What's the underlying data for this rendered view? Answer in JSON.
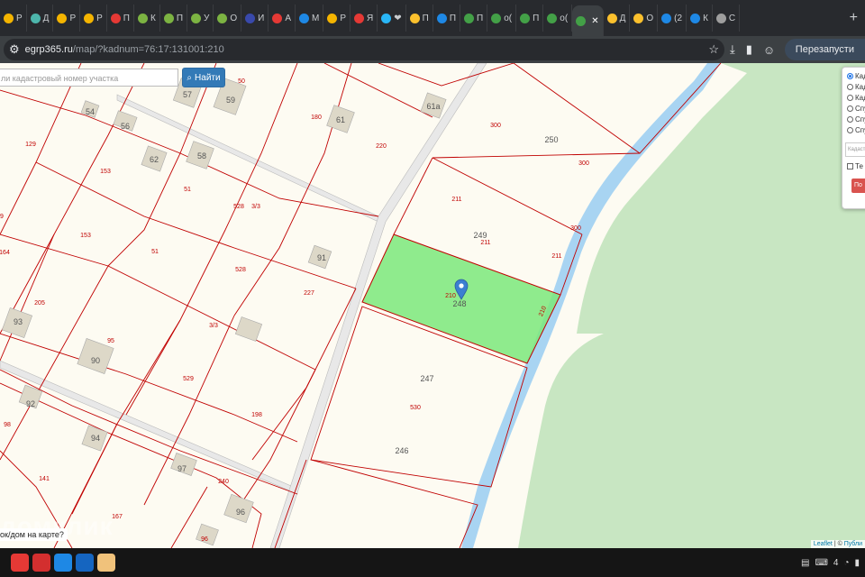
{
  "tabs": [
    {
      "label": "Р",
      "color": "#f4b400"
    },
    {
      "label": "Д",
      "color": "#4db6ac"
    },
    {
      "label": "Р",
      "color": "#f4b400"
    },
    {
      "label": "Р",
      "color": "#f4b400"
    },
    {
      "label": "П",
      "color": "#e53935"
    },
    {
      "label": "К",
      "color": "#7cb342"
    },
    {
      "label": "П",
      "color": "#7cb342"
    },
    {
      "label": "У",
      "color": "#7cb342"
    },
    {
      "label": "О",
      "color": "#7cb342"
    },
    {
      "label": "И",
      "color": "#3949ab"
    },
    {
      "label": "А",
      "color": "#e53935"
    },
    {
      "label": "М",
      "color": "#1e88e5"
    },
    {
      "label": "Р",
      "color": "#f4b400"
    },
    {
      "label": "Я",
      "color": "#e53935"
    },
    {
      "label": "❤",
      "color": "#29b6f6"
    },
    {
      "label": "П",
      "color": "#fbc02d"
    },
    {
      "label": "П",
      "color": "#1e88e5"
    },
    {
      "label": "П",
      "color": "#43a047"
    },
    {
      "label": "о(",
      "color": "#43a047"
    },
    {
      "label": "П",
      "color": "#43a047"
    },
    {
      "label": "о(",
      "color": "#43a047"
    },
    {
      "label": "",
      "color": "#43a047",
      "active": true
    },
    {
      "label": "Д",
      "color": "#fbc02d"
    },
    {
      "label": "О",
      "color": "#fbc02d"
    },
    {
      "label": "(2",
      "color": "#1e88e5"
    },
    {
      "label": "К",
      "color": "#1e88e5"
    },
    {
      "label": "С",
      "color": "#9e9e9e"
    }
  ],
  "toolbar": {
    "url_site": "egrp365.ru",
    "url_path": "/map/?kadnum=76:17:131001:210",
    "relaunch_label": "Перезапусти"
  },
  "map": {
    "search_placeholder": "ли кадастровый номер участка",
    "search_button": "Найти",
    "panel_options": [
      {
        "label": "Кад",
        "checked": true
      },
      {
        "label": "Кад",
        "checked": false
      },
      {
        "label": "Кад",
        "checked": false
      },
      {
        "label": "Спу",
        "checked": false
      },
      {
        "label": "Спу",
        "checked": false
      },
      {
        "label": "Спу",
        "checked": false
      }
    ],
    "panel_input_placeholder": "Кадаст",
    "panel_checkbox_label": "Те",
    "panel_button": "По",
    "attribution_leaflet": "Leaflet",
    "attribution_sep": " | © ",
    "attribution_source": "Публи",
    "bubble_text": "ок/дом на карте?",
    "watermark": "домклик",
    "selected_parcel": "210",
    "plot_labels": [
      {
        "t": "50"
      },
      {
        "t": "129"
      },
      {
        "t": "153"
      },
      {
        "t": "180"
      },
      {
        "t": "220"
      },
      {
        "t": "300"
      },
      {
        "t": "300"
      },
      {
        "t": "51"
      },
      {
        "t": "528"
      },
      {
        "t": "3/3"
      },
      {
        "t": "211"
      },
      {
        "t": "211"
      },
      {
        "t": "211"
      },
      {
        "t": "300"
      },
      {
        "t": "9"
      },
      {
        "t": "153"
      },
      {
        "t": "51"
      },
      {
        "t": "164"
      },
      {
        "t": "528"
      },
      {
        "t": "227"
      },
      {
        "t": "210"
      },
      {
        "t": "205"
      },
      {
        "t": "95"
      },
      {
        "t": "3/3"
      },
      {
        "t": "210"
      },
      {
        "t": "529"
      },
      {
        "t": "198"
      },
      {
        "t": "530"
      },
      {
        "t": "98"
      },
      {
        "t": "141"
      },
      {
        "t": "240"
      },
      {
        "t": "167"
      },
      {
        "t": "96"
      }
    ],
    "house_numbers": [
      {
        "t": "57"
      },
      {
        "t": "59"
      },
      {
        "t": "54"
      },
      {
        "t": "56"
      },
      {
        "t": "61"
      },
      {
        "t": "61а"
      },
      {
        "t": "58"
      },
      {
        "t": "62"
      },
      {
        "t": "91"
      },
      {
        "t": "93"
      },
      {
        "t": "90"
      },
      {
        "t": "92"
      },
      {
        "t": "94"
      },
      {
        "t": "97"
      },
      {
        "t": "96"
      }
    ],
    "block_numbers": [
      {
        "t": "250"
      },
      {
        "t": "249"
      },
      {
        "t": "248"
      },
      {
        "t": "247"
      },
      {
        "t": "246"
      }
    ]
  },
  "taskbar": {
    "apps": [
      {
        "name": "chrome-app-icon",
        "color": "#e53935"
      },
      {
        "name": "gallery-app-icon",
        "color": "#d32f2f"
      },
      {
        "name": "camera-app-icon",
        "color": "#1e88e5"
      },
      {
        "name": "docs-app-icon",
        "color": "#1565c0"
      },
      {
        "name": "files-app-icon",
        "color": "#f0c27b"
      }
    ],
    "tray_count": "4"
  }
}
